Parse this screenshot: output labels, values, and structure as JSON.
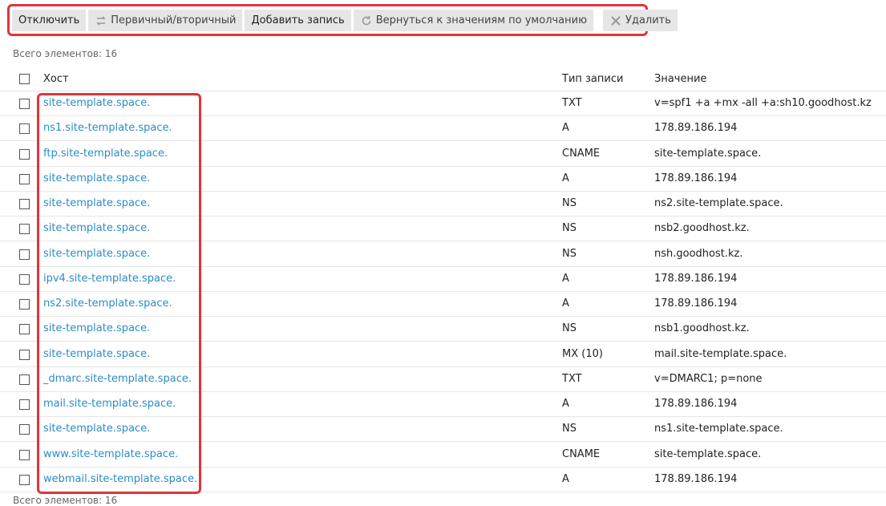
{
  "toolbar": {
    "buttons": [
      {
        "label": "Отключить",
        "icon": ""
      },
      {
        "label": "Первичный/вторичный",
        "icon": "swap-arrows-icon"
      },
      {
        "label": "Добавить запись",
        "icon": ""
      },
      {
        "label": "Вернуться к значениям по умолчанию",
        "icon": "restore-icon"
      },
      {
        "label": "Удалить",
        "icon": "delete-x-icon"
      }
    ]
  },
  "total_label": "Всего элементов: 16",
  "table": {
    "headers": {
      "host": "Хост",
      "type": "Тип записи",
      "value": "Значение"
    },
    "rows": [
      {
        "host": "site-template.space.",
        "type": "TXT",
        "value": "v=spf1 +a +mx -all +a:sh10.goodhost.kz"
      },
      {
        "host": "ns1.site-template.space.",
        "type": "A",
        "value": "178.89.186.194"
      },
      {
        "host": "ftp.site-template.space.",
        "type": "CNAME",
        "value": "site-template.space."
      },
      {
        "host": "site-template.space.",
        "type": "A",
        "value": "178.89.186.194"
      },
      {
        "host": "site-template.space.",
        "type": "NS",
        "value": "ns2.site-template.space."
      },
      {
        "host": "site-template.space.",
        "type": "NS",
        "value": "nsb2.goodhost.kz."
      },
      {
        "host": "site-template.space.",
        "type": "NS",
        "value": "nsh.goodhost.kz."
      },
      {
        "host": "ipv4.site-template.space.",
        "type": "A",
        "value": "178.89.186.194"
      },
      {
        "host": "ns2.site-template.space.",
        "type": "A",
        "value": "178.89.186.194"
      },
      {
        "host": "site-template.space.",
        "type": "NS",
        "value": "nsb1.goodhost.kz."
      },
      {
        "host": "site-template.space.",
        "type": "MX (10)",
        "value": "mail.site-template.space."
      },
      {
        "host": "_dmarc.site-template.space.",
        "type": "TXT",
        "value": "v=DMARC1; p=none"
      },
      {
        "host": "mail.site-template.space.",
        "type": "A",
        "value": "178.89.186.194"
      },
      {
        "host": "site-template.space.",
        "type": "NS",
        "value": "ns1.site-template.space."
      },
      {
        "host": "www.site-template.space.",
        "type": "CNAME",
        "value": "site-template.space."
      },
      {
        "host": "webmail.site-template.space.",
        "type": "A",
        "value": "178.89.186.194"
      }
    ]
  },
  "colors": {
    "link": "#2a8dc5",
    "highlight": "#e2343b",
    "button_bg": "#e6e6e6"
  }
}
